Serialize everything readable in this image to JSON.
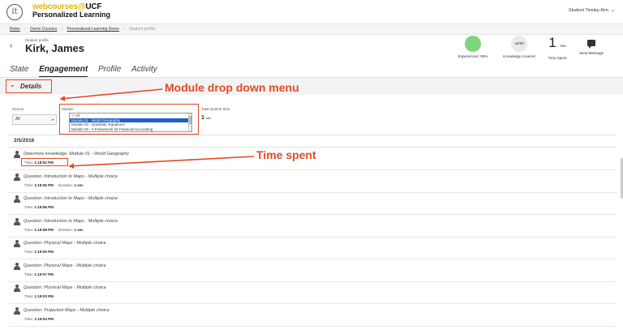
{
  "topbar": {
    "logo_glyph": "it",
    "brand_web": "webcourses",
    "brand_at": "@",
    "brand_ucf": "UCF",
    "brand_line2": "Personalized Learning",
    "user_name": "Student Tinsley-Kim",
    "user_chevron": "⌄"
  },
  "breadcrumb": {
    "items": [
      "Roles",
      "Demo Courses",
      "Personalized Learning Demo"
    ],
    "current": "Student profile",
    "separator": "/"
  },
  "profile": {
    "back_glyph": "‹",
    "label": "Student profile",
    "name": "Kirk, James"
  },
  "stats": {
    "experienced_label": "Experienced: 85%",
    "knowledge_value": "44/60",
    "knowledge_label": "Knowledge covered",
    "time_value": "1",
    "time_unit": "min",
    "time_label": "Time Spent",
    "message_label": "Send Message"
  },
  "tabs": [
    "State",
    "Engagement",
    "Profile",
    "Activity"
  ],
  "details": {
    "chevron": "⌄",
    "label": "Details"
  },
  "annotations": {
    "module": "Module drop down menu",
    "time": "Time spent"
  },
  "filters": {
    "source_label": "Source",
    "source_value": "All",
    "source_dropdown_glyph": "▾",
    "module_label": "Module",
    "module_options": [
      {
        "label": "✓ All",
        "selected": false
      },
      {
        "label": "Module 01 - World Geography",
        "selected": true
      },
      {
        "label": "Module 03 - Quadratic Equations",
        "selected": false
      },
      {
        "label": "Module 02 - A Framework for Financial Accounting",
        "selected": false
      }
    ],
    "total_label": "Total student time",
    "total_value": "1",
    "total_unit": "min"
  },
  "activity": {
    "date": "2/5/2016",
    "time_prefix": "Time:",
    "duration_prefix": "Duration:",
    "rows": [
      {
        "title": "Determine knowledge: Module 01 - World Geography",
        "time": "1:18:52 PM",
        "duration": ""
      },
      {
        "title": "Question: Introduction to Maps - Multiple choice",
        "time": "1:18:55 PM",
        "duration": "1 sec"
      },
      {
        "title": "Question: Introduction to Maps - Multiple choice",
        "time": "1:18:56 PM",
        "duration": ""
      },
      {
        "title": "Question: Introduction to Maps - Multiple choice",
        "time": "1:18:58 PM",
        "duration": "1 sec"
      },
      {
        "title": "Question: Physical Maps - Multiple choice",
        "time": "1:19:00 PM",
        "duration": ""
      },
      {
        "title": "Question: Physical Maps - Multiple choice",
        "time": "1:19:07 PM",
        "duration": ""
      },
      {
        "title": "Question: Physical Maps - Multiple choice",
        "time": "1:19:03 PM",
        "duration": ""
      },
      {
        "title": "Question: Projection Maps - Multiple choice",
        "time": "1:19:04 PM",
        "duration": ""
      }
    ]
  },
  "colors": {
    "annotation": "#e34a25",
    "experienced": "#7ed67a",
    "selected_option": "#1e5fc9",
    "brand_yellow": "#e8b400"
  },
  "icons": [
    "person-icon",
    "chat-icon",
    "back-arrow-icon",
    "chevron-down-icon"
  ]
}
